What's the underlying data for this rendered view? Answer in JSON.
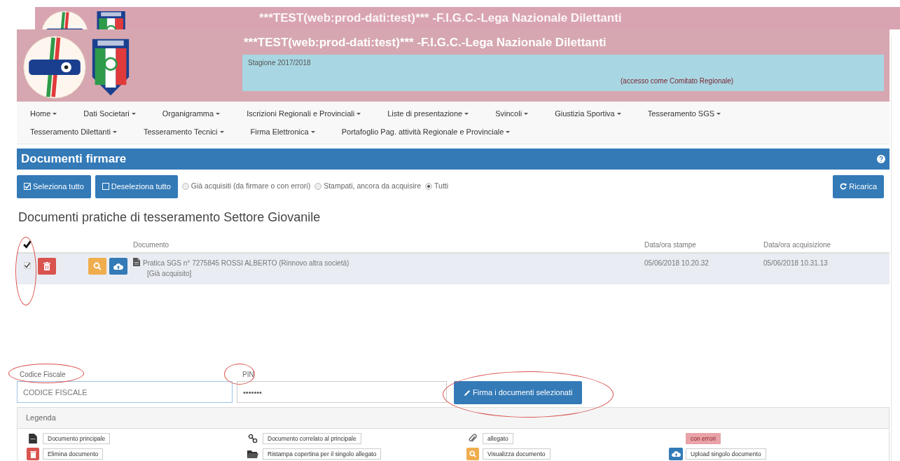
{
  "background_window": {
    "title": "***TEST(web:prod-dati:test)*** -F.I.G.C.-Lega Nazionale Dilettanti"
  },
  "header": {
    "title": "***TEST(web:prod-dati:test)*** -F.I.G.C.-Lega Nazionale Dilettanti",
    "season": "Stagione 2017/2018",
    "access": "(accesso come Comitato Regionale)"
  },
  "menu_rows": [
    [
      "Home",
      "Dati Societari",
      "Organigramma",
      "Iscrizioni Regionali e Provinciali",
      "Liste di presentazione",
      "Svincoli",
      "Giustizia Sportiva",
      "Tesseramento SGS"
    ],
    [
      "Tesseramento Dilettanti",
      "Tesseramento Tecnici",
      "Firma Elettronica",
      "Portafoglio Pag. attività Regionale e Provinciale"
    ]
  ],
  "panel": {
    "title": "Documenti firmare"
  },
  "toolbar": {
    "buttons": [
      {
        "kind": "select-all",
        "label": "Seleziona tutto"
      },
      {
        "kind": "deselect-all",
        "label": "Deseleziona tutto"
      }
    ],
    "filters": [
      {
        "label": "Già acquisiti (da firmare o con errori)",
        "selected": false
      },
      {
        "label": "Stampati, ancora da acquisire",
        "selected": false
      },
      {
        "label": "Tutti",
        "selected": true
      }
    ],
    "reload": "Ricarica"
  },
  "section_title": "Documenti pratiche di tesseramento Settore Giovanile",
  "table": {
    "select_all_checked": true,
    "columns": [
      "Documento",
      "Data/ora stampe",
      "Data/ora acquisizione"
    ],
    "rows": [
      {
        "checked": true,
        "document": "Pratica SGS n° 7275845 ROSSI ALBERTO (Rinnovo altra società)",
        "status": "[Già acquisito]",
        "printed": "05/06/2018 10.20.32",
        "acquired": "05/06/2018 10.31.13"
      }
    ]
  },
  "form": {
    "fiscal_code": {
      "label": "Codice Fiscale",
      "placeholder": "CODICE FISCALE"
    },
    "pin": {
      "label": "PIN",
      "value": "•••••••"
    },
    "submit": "Firma i documenti selezionati"
  },
  "legend": {
    "title": "Legenda",
    "columns": [
      [
        {
          "kind": "main-document",
          "label": "Documento principale"
        },
        {
          "kind": "delete",
          "label": "Elimina documento"
        }
      ],
      [
        {
          "kind": "related",
          "label": "Documento correlato al principale"
        },
        {
          "kind": "folder",
          "label": "Ristampa copertina per il singolo allegato"
        }
      ],
      [
        {
          "kind": "attachment",
          "label": "allegato"
        },
        {
          "kind": "view",
          "label": "Visualizza documento"
        }
      ],
      [
        {
          "kind": "error",
          "label": "con errori"
        },
        {
          "kind": "upload",
          "label": "Upload singolo documento"
        }
      ]
    ]
  }
}
